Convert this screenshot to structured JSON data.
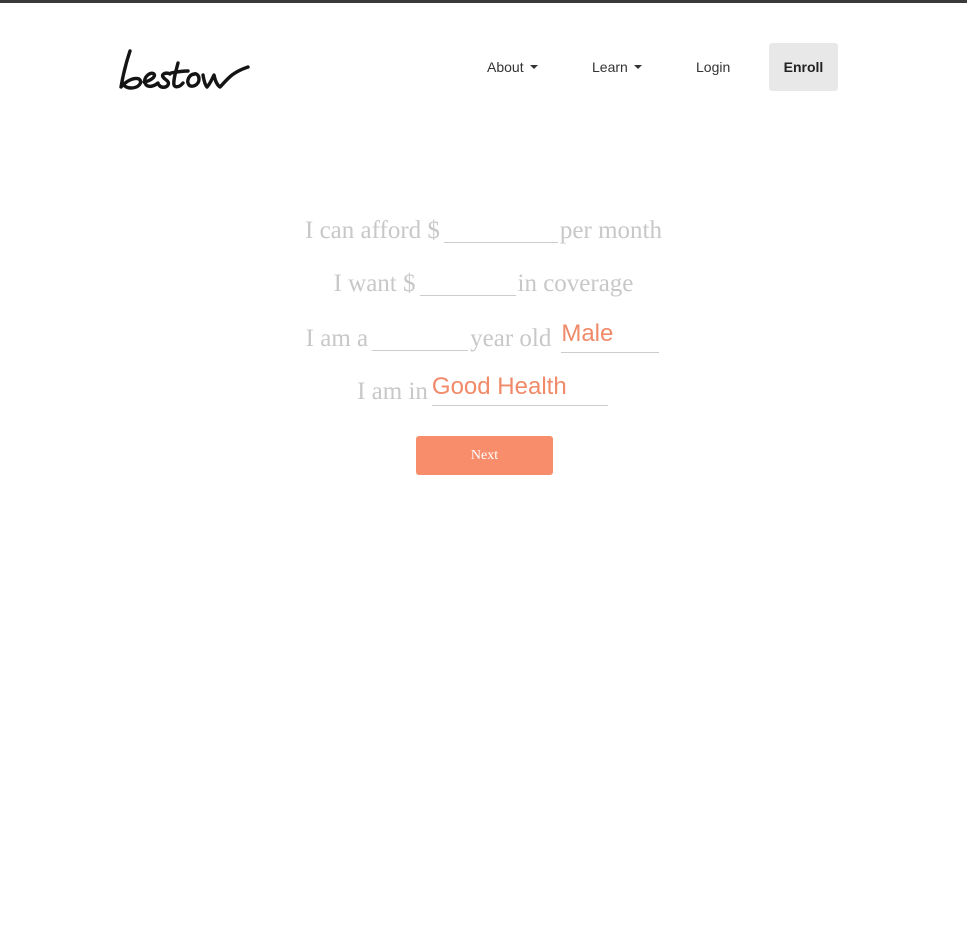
{
  "brand": {
    "logo_text": "bestow"
  },
  "nav": {
    "about_label": "About",
    "learn_label": "Learn",
    "login_label": "Login",
    "enroll_label": "Enroll"
  },
  "form": {
    "afford": {
      "prefix": "I can afford $",
      "value": "",
      "suffix": "per month"
    },
    "coverage": {
      "prefix": "I want $",
      "value": "",
      "suffix": "in coverage"
    },
    "age": {
      "prefix": "I am a",
      "value": "",
      "middle": "year old",
      "gender_value": "Male"
    },
    "health": {
      "prefix": "I am in",
      "value": "Good Health"
    },
    "next_label": "Next"
  },
  "colors": {
    "accent": "#f88d6c",
    "select_text": "#f08a69",
    "muted_text": "#c8c8c8",
    "enroll_bg": "#e8e8e8"
  }
}
